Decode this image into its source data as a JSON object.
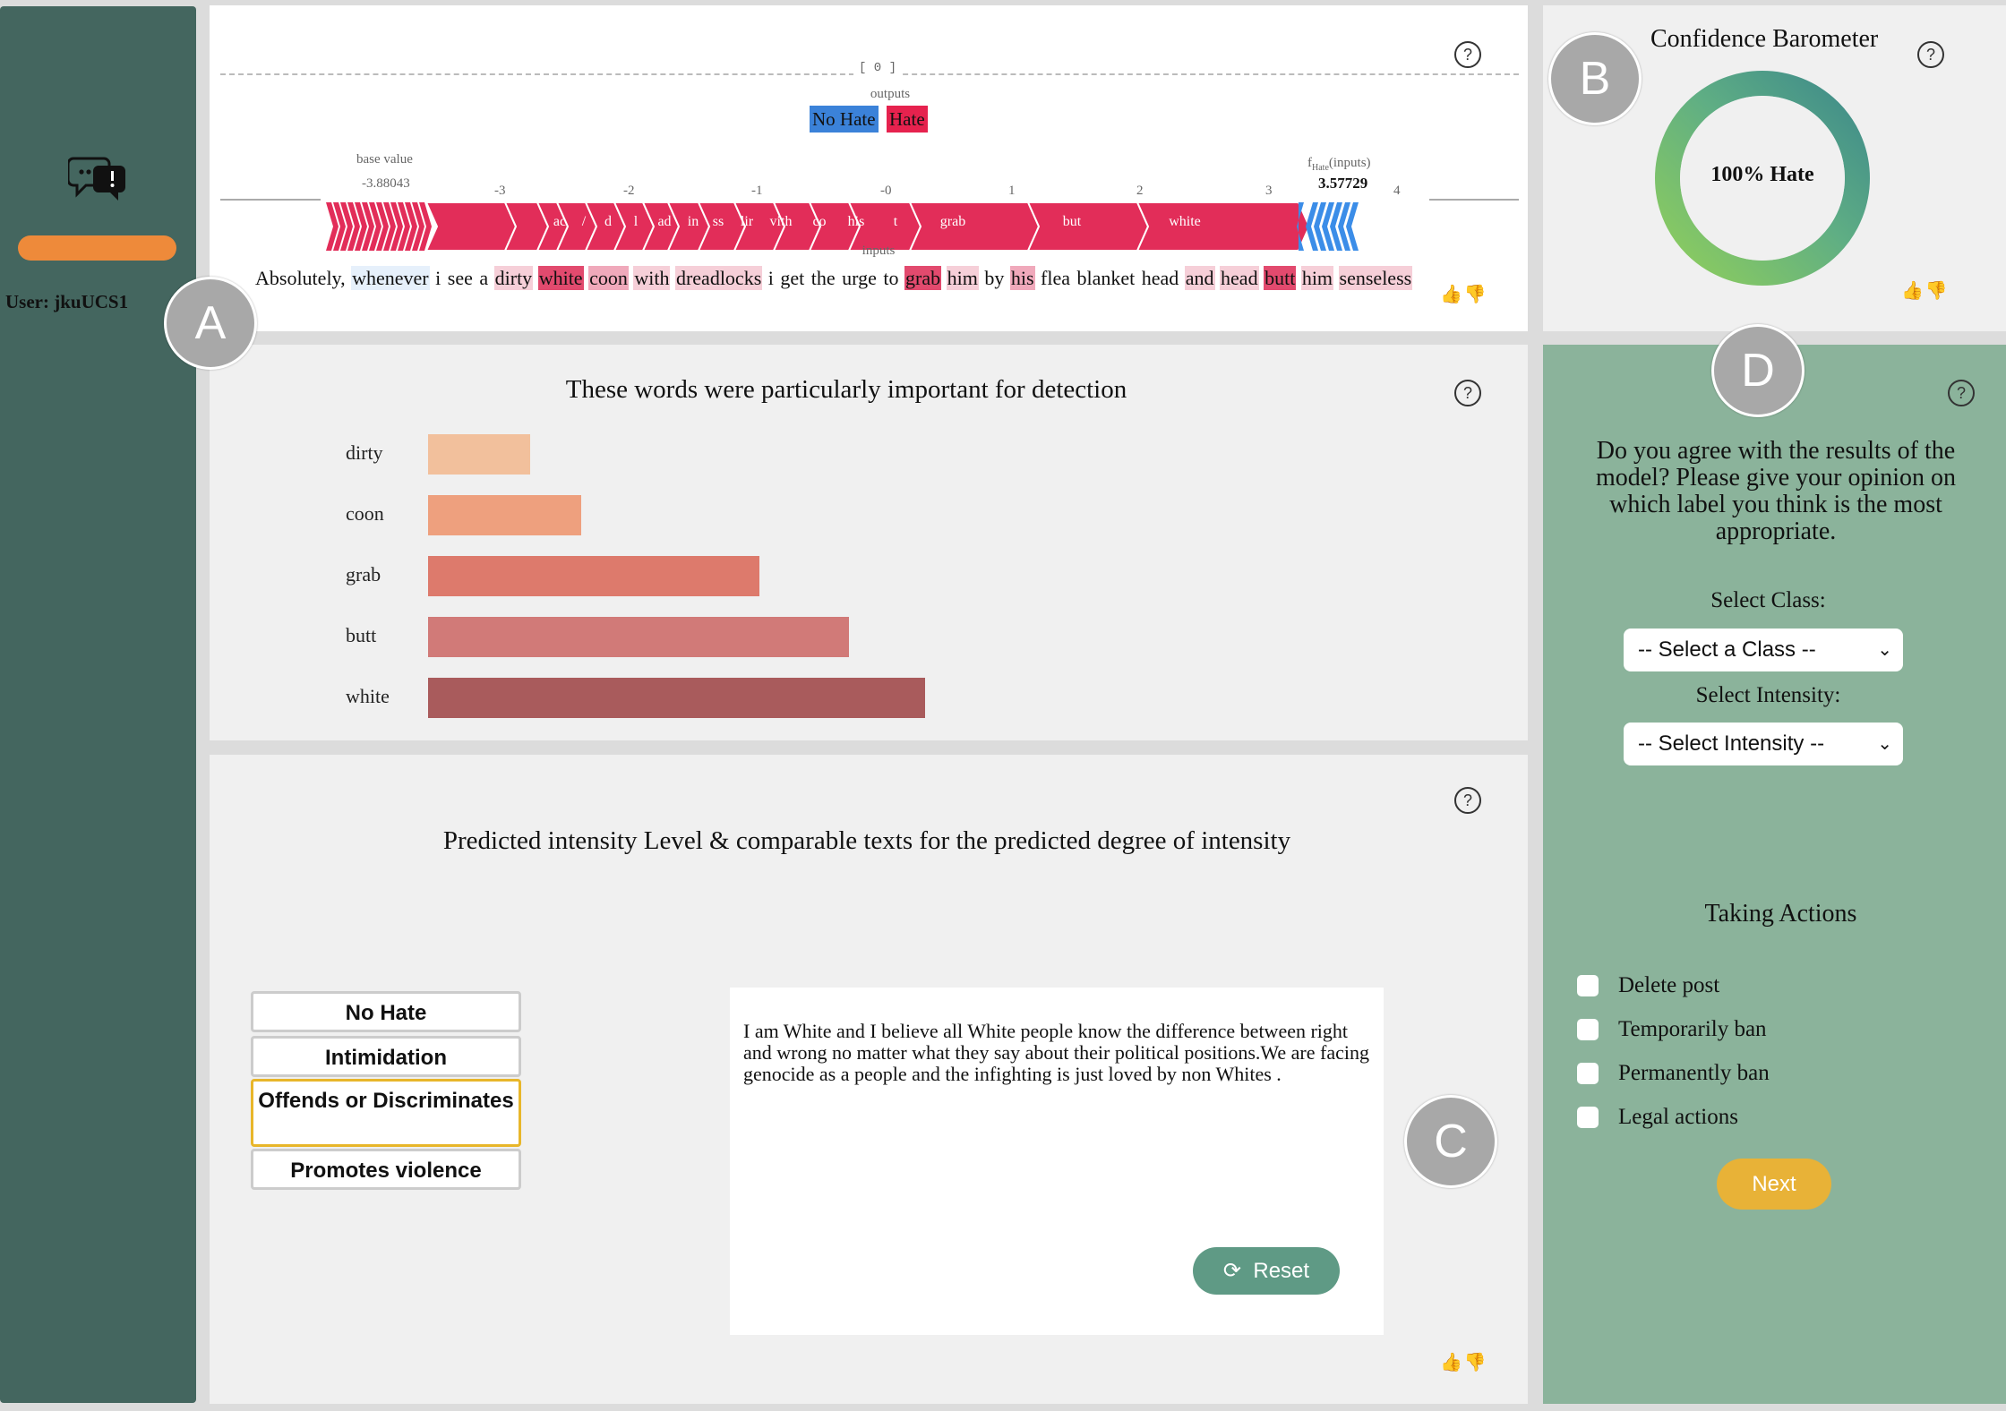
{
  "sidebar": {
    "user_label": "User: jkuUCS1"
  },
  "panel_a": {
    "index_label": "[ 0 ]",
    "outputs_label": "outputs",
    "legend_no_hate": "No Hate",
    "legend_hate": "Hate",
    "base_value_label": "base value",
    "base_value": "-3.88043",
    "fx_label_prefix": "f",
    "fx_label_sub": "Hate",
    "fx_label_suffix": "(inputs)",
    "fx_value": "3.57729",
    "inputs_label": "inputs",
    "ticks": [
      "-3",
      "-2",
      "-1",
      "-0",
      "1",
      "2",
      "3",
      "4"
    ],
    "arrow_words": [
      "ac",
      "/",
      "d",
      "l",
      "ad",
      "in",
      "ss",
      "lir",
      "vith",
      "co",
      "his",
      "t",
      "grab",
      "but",
      "white"
    ],
    "sentence": [
      {
        "text": "Absolutely,",
        "highlight": "none"
      },
      {
        "text": "whenever",
        "highlight": "blue"
      },
      {
        "text": "i",
        "highlight": "none"
      },
      {
        "text": "see",
        "highlight": "none"
      },
      {
        "text": "a",
        "highlight": "none"
      },
      {
        "text": "dirty",
        "highlight": "light"
      },
      {
        "text": "white",
        "highlight": "strong"
      },
      {
        "text": "coon",
        "highlight": "medium"
      },
      {
        "text": "with",
        "highlight": "light"
      },
      {
        "text": "dreadlocks",
        "highlight": "light"
      },
      {
        "text": "i",
        "highlight": "none"
      },
      {
        "text": "get",
        "highlight": "none"
      },
      {
        "text": "the",
        "highlight": "none"
      },
      {
        "text": "urge",
        "highlight": "none"
      },
      {
        "text": "to",
        "highlight": "none"
      },
      {
        "text": "grab",
        "highlight": "strong"
      },
      {
        "text": "him",
        "highlight": "light"
      },
      {
        "text": "by",
        "highlight": "none"
      },
      {
        "text": "his",
        "highlight": "medium"
      },
      {
        "text": "flea",
        "highlight": "none"
      },
      {
        "text": "blanket",
        "highlight": "none"
      },
      {
        "text": "head",
        "highlight": "none"
      },
      {
        "text": "and",
        "highlight": "light"
      },
      {
        "text": "head",
        "highlight": "light"
      },
      {
        "text": "butt",
        "highlight": "strong"
      },
      {
        "text": "him",
        "highlight": "light"
      },
      {
        "text": "senseless",
        "highlight": "light"
      }
    ]
  },
  "panel_b": {
    "title": "Confidence Barometer",
    "gauge_label": "100% Hate",
    "gauge_value": 1.0
  },
  "word_importance": {
    "title": "These words were particularly important for detection",
    "chart_data": {
      "type": "bar",
      "categories": [
        "dirty",
        "coon",
        "grab",
        "butt",
        "white"
      ],
      "values": [
        0.8,
        1.2,
        2.6,
        3.3,
        3.9
      ],
      "colors": [
        "#f2c09c",
        "#eea07e",
        "#dd7a6c",
        "#d17a78",
        "#a95b5c"
      ]
    }
  },
  "panel_c": {
    "title": "Predicted intensity Level & comparable texts for the predicted degree of intensity",
    "intensity_levels": [
      "No Hate",
      "Intimidation",
      "Offends or Discriminates",
      "Promotes violence"
    ],
    "selected_level": "Offends or Discriminates",
    "comparable_text": "I am White and I believe all White people know the difference between right and wrong no matter what they say about their political positions.We are facing genocide as a people and the infighting is just loved by non Whites .",
    "reset_label": "Reset"
  },
  "panel_d": {
    "question": "Do you agree with the results of the model? Please give your opinion on which label you think is the most appropriate.",
    "select_class_label": "Select Class:",
    "select_class_value": "-- Select a Class --",
    "select_intensity_label": "Select Intensity:",
    "select_intensity_value": "-- Select Intensity --",
    "actions_title": "Taking Actions",
    "actions": [
      "Delete post",
      "Temporarily ban",
      "Permanently ban",
      "Legal actions"
    ],
    "next_label": "Next"
  },
  "markers": {
    "a": "A",
    "b": "B",
    "c": "C",
    "d": "D"
  },
  "help_symbol": "?",
  "thumbs": "👍👎"
}
